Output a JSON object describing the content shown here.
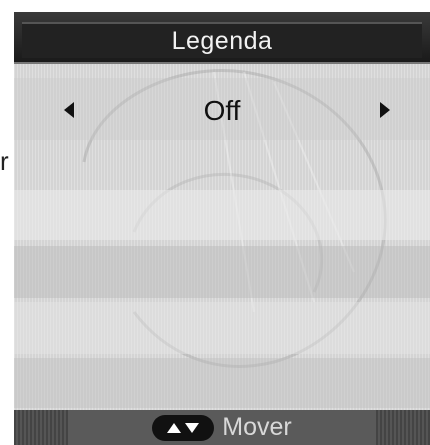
{
  "edge_fragment": "r",
  "title": "Legenda",
  "option": {
    "value": "Off",
    "prev_icon": "triangle-left-icon",
    "next_icon": "triangle-right-icon"
  },
  "footer": {
    "nav_icon": "up-down-arrows-icon",
    "label": "Mover"
  },
  "colors": {
    "title_bar": "#1a1a1a",
    "panel": "#d4d4d4",
    "footer": "#5a5a5a"
  }
}
